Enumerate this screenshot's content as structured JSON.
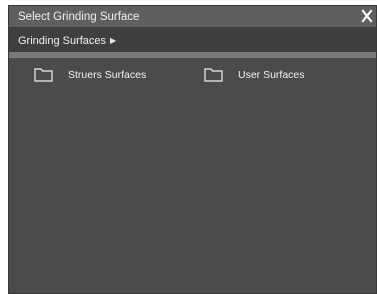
{
  "window": {
    "title": "Select Grinding Surface",
    "close_glyph": "X"
  },
  "breadcrumb": {
    "items": [
      {
        "label": "Grinding Surfaces",
        "arrow": "▶"
      }
    ]
  },
  "folders": [
    {
      "label": "Struers Surfaces",
      "icon": "folder-icon"
    },
    {
      "label": "User Surfaces",
      "icon": "folder-icon"
    }
  ],
  "colors": {
    "titlebar": "#5f5f5f",
    "breadcrumb_bar": "#3f3f3f",
    "separator": "#7a7a7a",
    "content_bg": "#4b4b4b",
    "text": "#f2f2f2"
  }
}
